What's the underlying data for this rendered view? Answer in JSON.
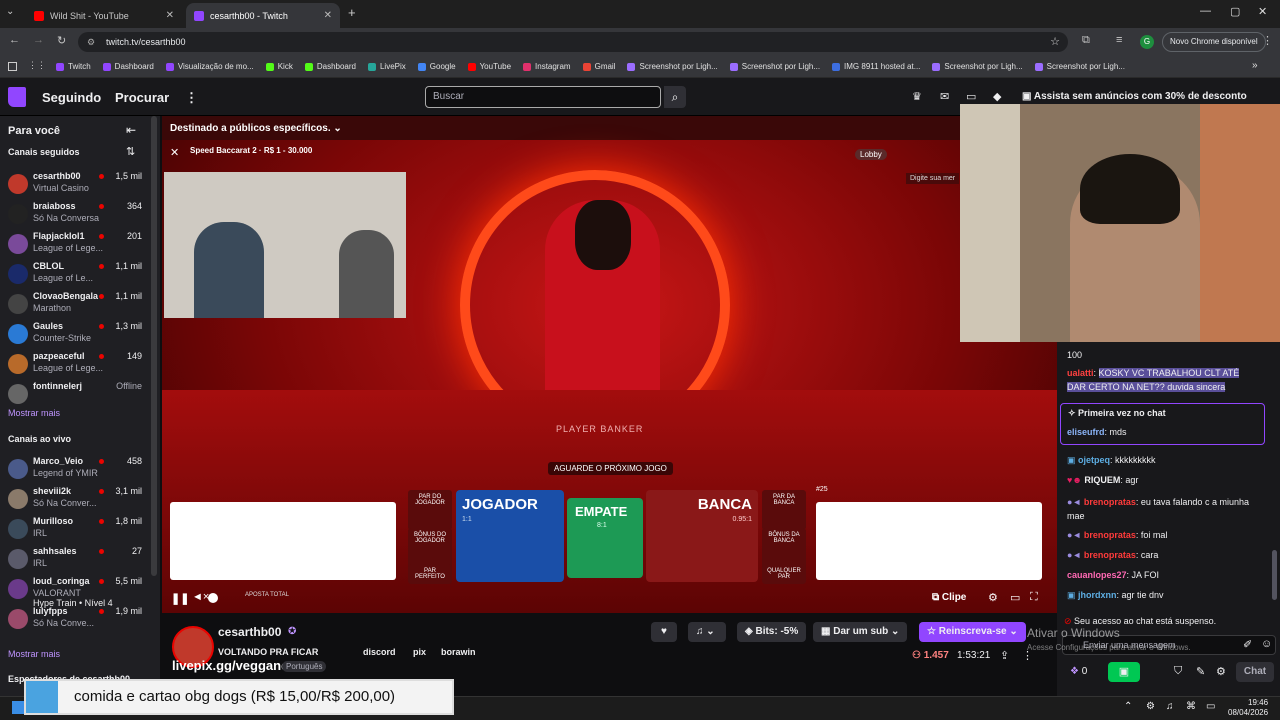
{
  "browser": {
    "tabs": [
      {
        "label": "Wild Shit - YouTube",
        "active": false
      },
      {
        "label": "cesarthb00 - Twitch",
        "active": true
      }
    ],
    "new_tab": "+",
    "url": "twitch.tv/cesarthb00",
    "profile_initial": "G",
    "update_button": "Novo Chrome disponível",
    "bookmarks": [
      "Twitch",
      "Dashboard",
      "Visualização de mo...",
      "Kick",
      "Dashboard",
      "LivePix",
      "Google",
      "YouTube",
      "Instagram",
      "Gmail",
      "Screenshot por Ligh...",
      "Screenshot por Ligh...",
      "IMG 8911 hosted at...",
      "Screenshot por Ligh...",
      "Screenshot por Ligh..."
    ],
    "bookmark_colors": [
      "#9146ff",
      "#9146ff",
      "#9146ff",
      "#53fc18",
      "#53fc18",
      "#26a69a",
      "#4285f4",
      "#ff0000",
      "#e1306c",
      "#ea4335",
      "#9b6dff",
      "#9b6dff",
      "#3d6ee0",
      "#9b6dff",
      "#9b6dff"
    ]
  },
  "twitch_nav": {
    "following": "Seguindo",
    "browse": "Procurar",
    "more_icon": "⋮",
    "search_placeholder": "Buscar",
    "promo": "Assista sem anúncios com 30% de desconto"
  },
  "sidebar": {
    "title": "Para você",
    "followed_header": "Canais seguidos",
    "followed": [
      {
        "name": "cesarthb00",
        "game": "Virtual Casino",
        "viewers": "1,5 mil",
        "color": "#c0392b"
      },
      {
        "name": "braiaboss",
        "game": "Só Na Conversa",
        "viewers": "364",
        "color": "#222"
      },
      {
        "name": "Flapjacklol1",
        "game": "League of Lege...",
        "viewers": "201",
        "color": "#7a4a9a"
      },
      {
        "name": "CBLOL",
        "game": "League of Le...",
        "viewers": "1,1 mil",
        "color": "#1a2a6a"
      },
      {
        "name": "ClovaoBengala",
        "game": "Marathon",
        "viewers": "1,1 mil",
        "color": "#444"
      },
      {
        "name": "Gaules",
        "game": "Counter-Strike",
        "viewers": "1,3 mil",
        "color": "#2a7ad5"
      },
      {
        "name": "pazpeaceful",
        "game": "League of Lege...",
        "viewers": "149",
        "color": "#b86a2a"
      },
      {
        "name": "fontinnelerj",
        "game": "",
        "viewers": "Offline",
        "color": "#666"
      }
    ],
    "show_more_1": "Mostrar mais",
    "live_header": "Canais ao vivo",
    "live": [
      {
        "name": "Marco_Veio",
        "game": "Legend of YMIR",
        "viewers": "458",
        "color": "#4a5a8a"
      },
      {
        "name": "sheviii2k",
        "game": "Só Na Conver...",
        "viewers": "3,1 mil",
        "color": "#8a7a6a"
      },
      {
        "name": "Murilloso",
        "game": "IRL",
        "viewers": "1,8 mil",
        "color": "#3a4a5a"
      },
      {
        "name": "sahhsales",
        "game": "IRL",
        "viewers": "27",
        "color": "#5a5a6a"
      },
      {
        "name": "loud_coringa",
        "game": "VALORANT",
        "viewers": "5,5 mil",
        "color": "#6a3a8a"
      },
      {
        "name": "lulyfpps",
        "game": "Só Na Conve...",
        "viewers": "1,9 mil",
        "color": "#9a4a6a"
      }
    ],
    "hype_train": "Hype Train • Nível 4",
    "show_more_2": "Mostrar mais",
    "similar_header": "Espectadores de cesarthb00"
  },
  "video": {
    "audience_label": "Destinado a públicos específicos.",
    "game_title": "Speed Baccarat 2 · R$ 1 - 30.000",
    "lobby": "Lobby",
    "chat_hint": "Digite sua mer",
    "dealer_text": "PLAYER BANKER",
    "wait_text": "AGUARDE O PRÓXIMO JOGO",
    "player": "JOGADOR",
    "player_odds": "1:1",
    "tie": "EMPATE",
    "tie_odds": "8:1",
    "banker": "BANCA",
    "banker_odds": "0.95:1",
    "player_pair": "PAR DO JOGADOR",
    "player_bonus": "BÔNUS DO JOGADOR",
    "perfect_pair": "PAR PERFEITO",
    "banker_pair": "PAR DA BANCA",
    "banker_bonus": "BÔNUS DA BANCA",
    "any_pair": "QUALQUER PAR",
    "total_bet": "APOSTA TOTAL",
    "round_counter": "#25",
    "clip": "Clipe"
  },
  "stream_info": {
    "channel": "cesarthb00",
    "title": "VOLTANDO PRA FICAR",
    "tags": [
      "discord",
      "pix",
      "borawin"
    ],
    "language": "Português",
    "livepix": "livepix.gg/veggano",
    "bits": "Bits: -5%",
    "gift_sub": "Dar um sub",
    "resubscribe": "Reinscreva-se",
    "viewers": "1.457",
    "uptime": "1:53:21"
  },
  "chat": {
    "messages": [
      {
        "user": "",
        "text": "100",
        "user_color": "#efeff1"
      },
      {
        "user": "ualatti",
        "text": "KOSKY VC TRABALHOU CLT ATÉ DAR CERTO NA NET?? duvida sincera",
        "user_color": "#ff4040",
        "highlight": true
      },
      {
        "user": "",
        "text": "Primeira vez no chat",
        "user_color": "#efeff1"
      },
      {
        "user": "eliseufrd",
        "text": "mds",
        "user_color": "#8ab4f8"
      },
      {
        "user": "ojetpeq",
        "text": "kkkkkkkkk",
        "user_color": "#5dade2"
      },
      {
        "user": "RIQUEM",
        "text": "agr",
        "user_color": "#efeff1"
      },
      {
        "user": "brenopratas",
        "text": "eu tava falando c a miunha mae",
        "user_color": "#ff3b3b"
      },
      {
        "user": "brenopratas",
        "text": "foi mal",
        "user_color": "#ff3b3b"
      },
      {
        "user": "brenopratas",
        "text": "cara",
        "user_color": "#ff3b3b"
      },
      {
        "user": "cauanlopes27",
        "text": "JA FOI",
        "user_color": "#ff69b4"
      },
      {
        "user": "jhordxnn",
        "text": "agr tie dnv",
        "user_color": "#5dade2"
      }
    ],
    "suspended": "Seu acesso ao chat está suspenso.",
    "input_placeholder": "Enviar uma mensagem",
    "points": "0",
    "send": "Chat",
    "windows_watermark_1": "Ativar o Windows",
    "windows_watermark_2": "Acesse Configurações para ativar o Windows."
  },
  "overlay_text": "comida e cartao obg dogs (R$ 15,00/R$ 200,00)",
  "taskbar": {
    "time": "19:46",
    "date": "08/04/2026"
  }
}
